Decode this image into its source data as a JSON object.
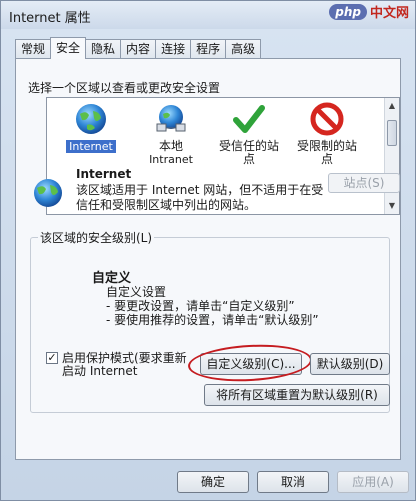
{
  "window": {
    "title": "Internet 属性"
  },
  "watermark_top": {
    "badge": "php",
    "text": "中文网"
  },
  "tabs": [
    {
      "label": "常规",
      "active": false
    },
    {
      "label": "安全",
      "active": true
    },
    {
      "label": "隐私",
      "active": false
    },
    {
      "label": "内容",
      "active": false
    },
    {
      "label": "连接",
      "active": false
    },
    {
      "label": "程序",
      "active": false
    },
    {
      "label": "高级",
      "active": false
    }
  ],
  "security": {
    "zone_caption": "选择一个区域以查看或更改安全设置",
    "zones": [
      {
        "label": "Internet",
        "icon": "globe-icon",
        "selected": true
      },
      {
        "label": "本地",
        "label2": "Intranet",
        "icon": "intranet-icon",
        "selected": false
      },
      {
        "label": "受信任的站",
        "label2": "点",
        "icon": "check-icon",
        "selected": false
      },
      {
        "label": "受限制的站",
        "label2": "点",
        "icon": "restricted-icon",
        "selected": false
      }
    ],
    "sites_button": "站点(S)",
    "selected_zone": {
      "title": "Internet",
      "description": "该区域适用于 Internet 网站，但不适用于在受信任和受限制区域中列出的网站。"
    },
    "level_group_label": "该区域的安全级别(L)",
    "level_name": "自定义",
    "level_lines": [
      "自定义设置",
      "- 要更改设置，请单击“自定义级别”",
      "- 要使用推荐的设置，请单击“默认级别”"
    ],
    "protected_mode": {
      "checked": true,
      "label_line1": "启用保护模式(要求重新",
      "label_line2": "启动 Internet"
    },
    "custom_level_button": "自定义级别(C)...",
    "default_level_button": "默认级别(D)",
    "reset_all_button": "将所有区域重置为默认级别(R)"
  },
  "footer": {
    "ok": "确定",
    "cancel": "取消",
    "apply": "应用(A)"
  },
  "colors": {
    "accent_selection": "#3d6fcb",
    "annotation_red": "#c51c20"
  }
}
